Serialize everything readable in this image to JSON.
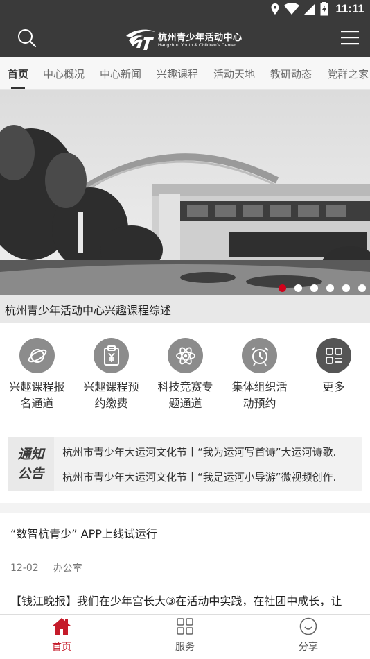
{
  "status_bar": {
    "time": "11:11",
    "icons": [
      "location-icon",
      "wifi-icon",
      "signal-icon",
      "battery-icon"
    ]
  },
  "header": {
    "logo_cn": "杭州青少年活动中心",
    "logo_en": "Hangzhou Youth & Children's Center",
    "search_icon": "search-icon",
    "menu_icon": "menu-icon"
  },
  "tabs": [
    {
      "label": "首页",
      "active": true
    },
    {
      "label": "中心概况"
    },
    {
      "label": "中心新闻"
    },
    {
      "label": "兴趣课程"
    },
    {
      "label": "活动天地"
    },
    {
      "label": "教研动态"
    },
    {
      "label": "党群之家"
    }
  ],
  "banner": {
    "caption": "杭州青少年活动中心兴趣课程综述",
    "slide_count": 6,
    "active_slide": 1
  },
  "services": [
    {
      "label": "兴趣课程报名通道",
      "icon": "planet-icon"
    },
    {
      "label": "兴趣课程预约缴费",
      "icon": "clipboard-yen-icon"
    },
    {
      "label": "科技竞赛专题通道",
      "icon": "atom-icon"
    },
    {
      "label": "集体组织活动预约",
      "icon": "alarm-clock-icon"
    },
    {
      "label": "更多",
      "icon": "more-grid-icon"
    }
  ],
  "notice": {
    "tag_line1": "通知",
    "tag_line2": "公告",
    "items": [
      "杭州市青少年大运河文化节丨“我为运河写首诗”大运河诗歌.",
      "杭州市青少年大运河文化节丨“我是运河小导游”微视频创作."
    ]
  },
  "news": {
    "title": "“数智杭青少” APP上线试运行",
    "date": "12-02",
    "source": "办公室",
    "excerpt": "【钱江晚报】我们在少年宫长大③在活动中实践，在社团中成长，让"
  },
  "bottom_nav": [
    {
      "label": "首页",
      "icon": "home-icon",
      "active": true
    },
    {
      "label": "服务",
      "icon": "grid-icon"
    },
    {
      "label": "分享",
      "icon": "smile-icon"
    }
  ],
  "colors": {
    "header_bg": "#3a3a3a",
    "accent_red": "#c51b2a",
    "icon_circle": "#8c8c8c"
  }
}
